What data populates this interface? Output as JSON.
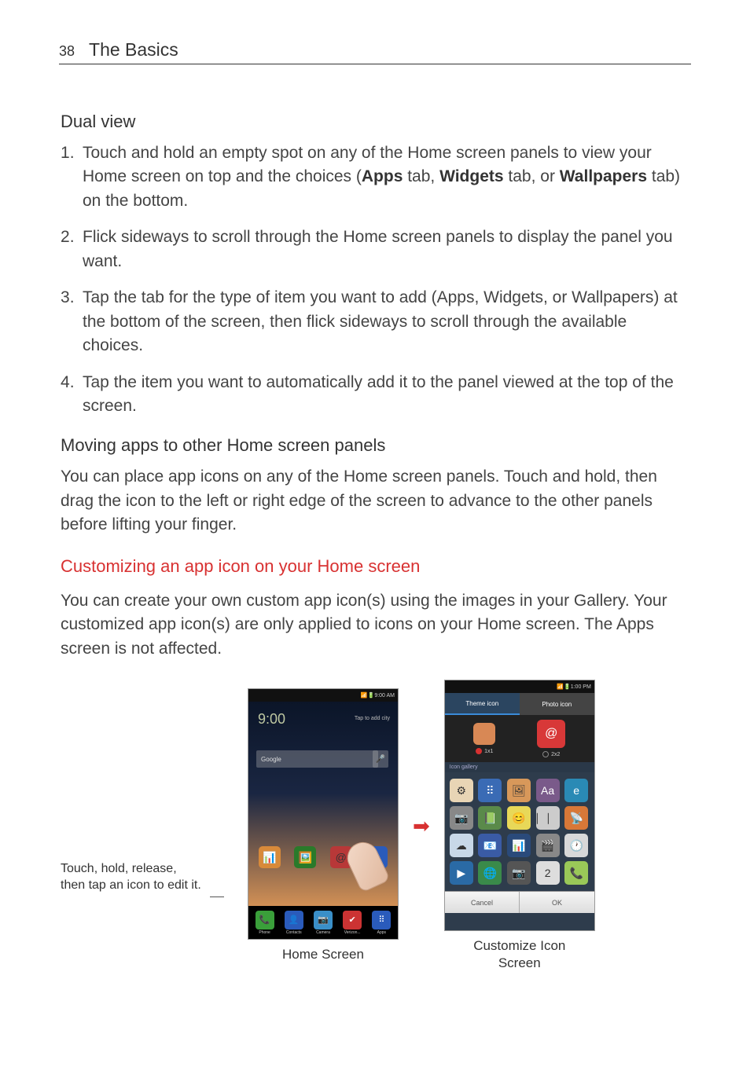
{
  "header": {
    "page_number": "38",
    "section_title": "The Basics"
  },
  "body": {
    "heading_dual": "Dual view",
    "steps": [
      "Touch and hold an empty spot on any of the Home screen panels to view your Home screen on top and the choices (Apps tab, Widgets tab, or Wallpapers tab) on the bottom.",
      "Flick sideways to scroll through the Home screen panels to display the panel you want.",
      "Tap the tab for the type of item you want to add (Apps, Widgets, or Wallpapers) at the bottom of the screen, then flick sideways to scroll through the available choices.",
      "Tap the item you want to automatically add it to the panel viewed at the top of the screen."
    ],
    "heading_moving": "Moving apps to other Home screen panels",
    "para_moving": "You can place app icons on any of the Home screen panels. Touch and hold, then drag the icon to the left or right edge of the screen to advance to the other panels before lifting your finger.",
    "heading_custom": "Customizing an app icon on your Home screen",
    "para_custom": "You can create your own custom app icon(s) using the images in your Gallery. Your customized app icon(s) are only applied to icons on your Home screen. The Apps screen is not affected."
  },
  "figure": {
    "callout_left": "Touch, hold, release, then tap an icon to edit it.",
    "home_screen": {
      "status_time": "9:00 AM",
      "clock": "9:00",
      "weather": "Tap to add city",
      "search_placeholder": "Google",
      "dock": {
        "items": [
          {
            "label": "Phone",
            "color": "#3a9f3a"
          },
          {
            "label": "Contacts",
            "color": "#2a5bbb"
          },
          {
            "label": "Camera",
            "color": "#3a8fc8"
          },
          {
            "label": "Verizon...",
            "color": "#cc3333"
          },
          {
            "label": "Apps",
            "color": "#2a5bbb"
          }
        ]
      },
      "apps": [
        {
          "color": "#d88a3a"
        },
        {
          "color": "#2a7a2a"
        },
        {
          "color": "#b83838"
        },
        {
          "color": "#2a5bbb"
        }
      ],
      "caption": "Home Screen"
    },
    "customize_screen": {
      "status_time": "1:00 PM",
      "tabs": {
        "theme": "Theme icon",
        "photo": "Photo icon"
      },
      "sizes": {
        "s1": {
          "label": "1x1",
          "selected": true
        },
        "s2": {
          "label": "2x2",
          "selected": false
        }
      },
      "gallery_label": "Icon gallery",
      "buttons": {
        "cancel": "Cancel",
        "ok": "OK"
      },
      "caption_line1": "Customize Icon",
      "caption_line2": "Screen"
    }
  }
}
